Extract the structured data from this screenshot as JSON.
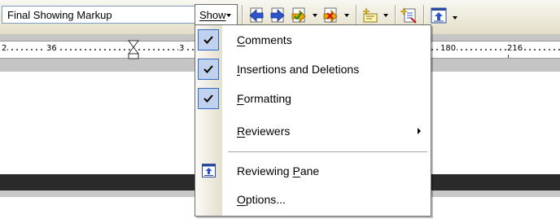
{
  "toolbar": {
    "display_mode": "Final Showing Markup",
    "show_label": "Show",
    "icons": [
      "previous-change-icon",
      "next-change-icon",
      "accept-change-icon",
      "reject-change-icon",
      "new-comment-icon",
      "track-changes-icon",
      "reviewing-pane-icon"
    ]
  },
  "ruler": {
    "numbers": [
      "2",
      "36",
      "3",
      "180",
      "216"
    ]
  },
  "menu": {
    "items": [
      {
        "label": "Comments",
        "mnemonic": "C",
        "rest": "omments",
        "checked": true
      },
      {
        "label": "Insertions and Deletions",
        "mnemonic": "I",
        "rest": "nsertions and Deletions",
        "checked": true
      },
      {
        "label": "Formatting",
        "mnemonic": "F",
        "rest": "ormatting",
        "checked": true
      },
      {
        "label": "Reviewers",
        "mnemonic": "R",
        "rest": "eviewers",
        "submenu": true
      },
      {
        "label": "Reviewing Pane",
        "prefix": "Reviewing ",
        "mnemonic": "P",
        "rest": "ane",
        "icon": "reviewing-pane-icon"
      },
      {
        "label": "Options...",
        "mnemonic": "O",
        "rest": "ptions..."
      }
    ]
  },
  "colors": {
    "toolbar_bg": "#ece9d8",
    "check_bg": "#c1d2ee",
    "check_border": "#316ac5",
    "accent_arrow": "#e8a800"
  }
}
